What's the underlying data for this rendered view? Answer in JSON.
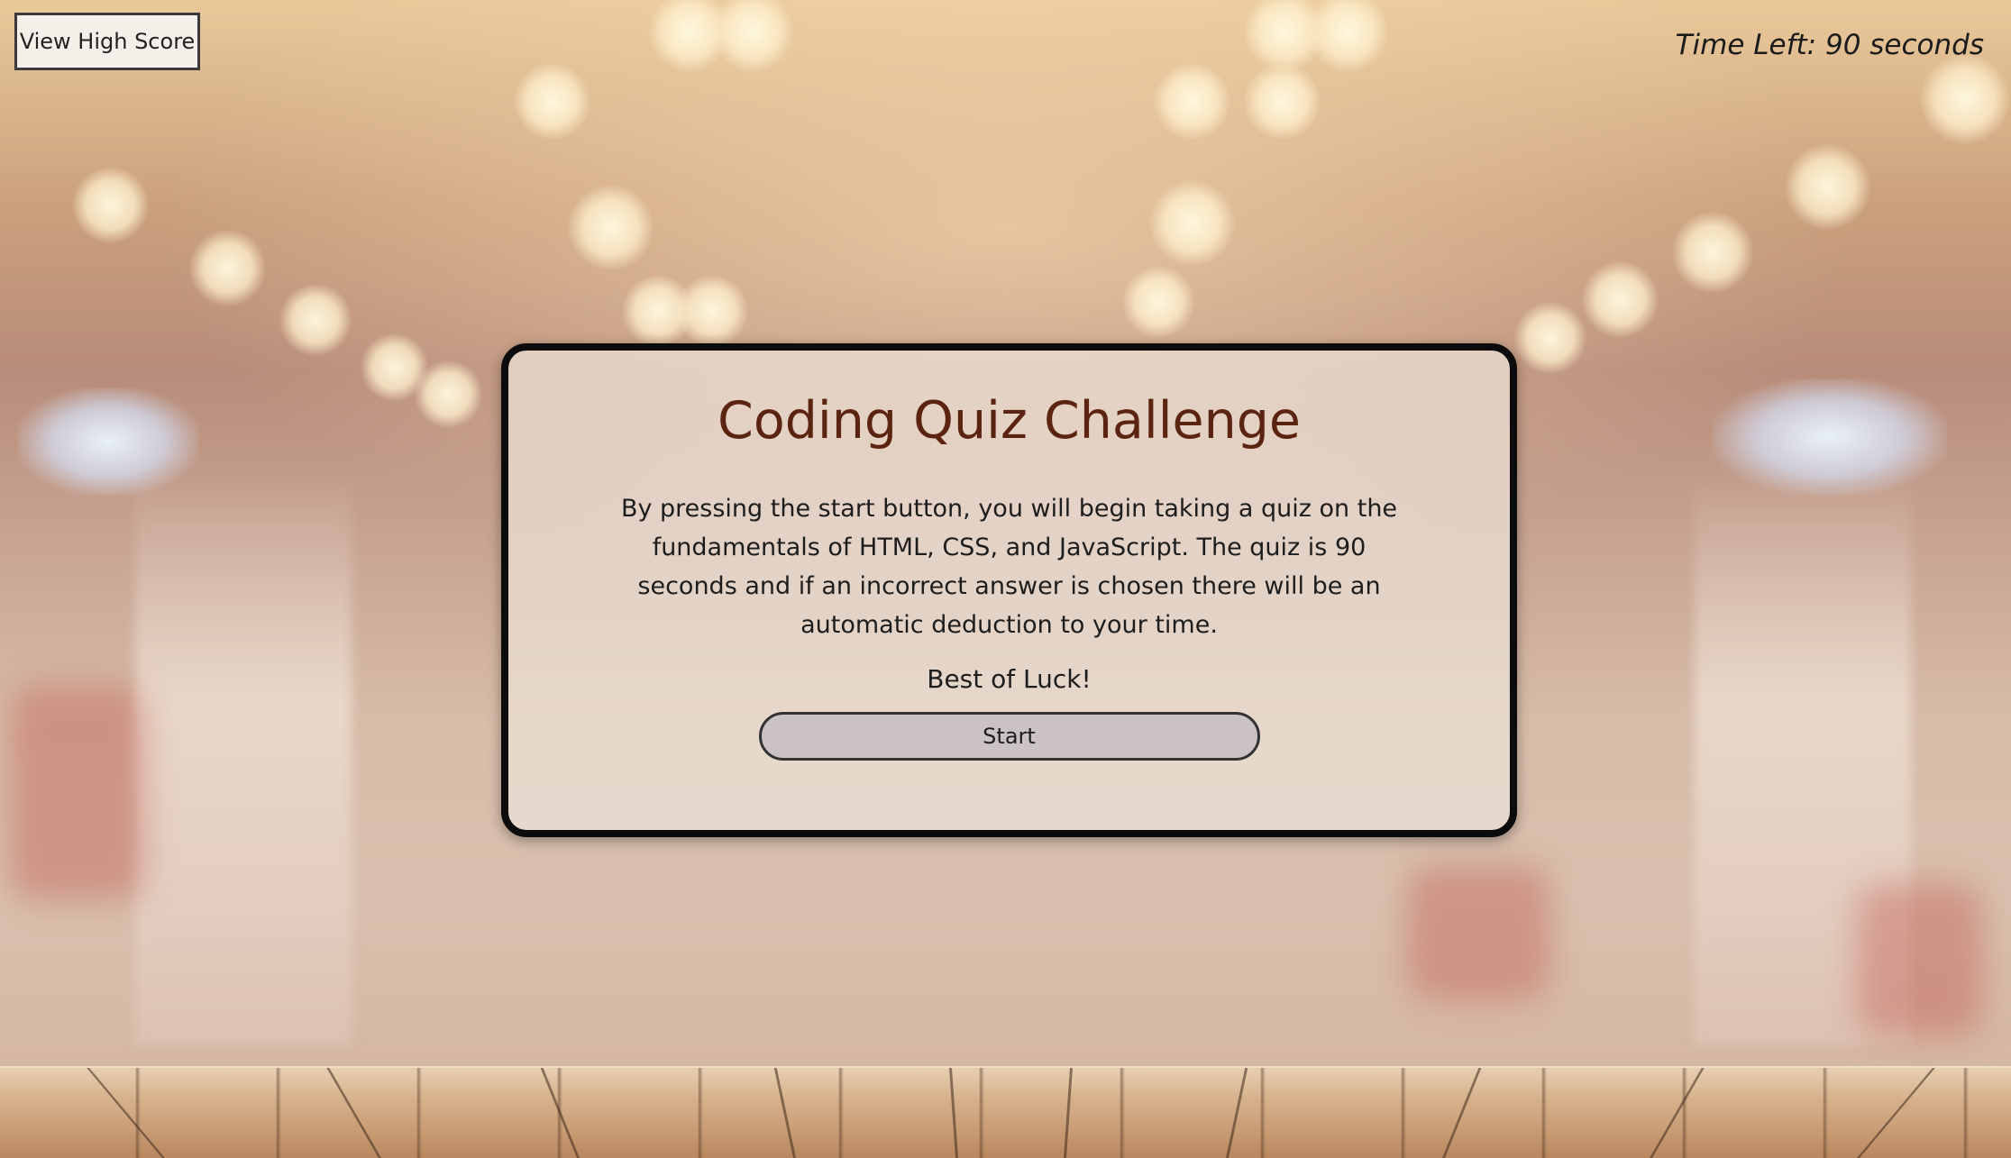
{
  "header": {
    "high_score_label": "View High Score",
    "timer_text": "Time Left: 90 seconds"
  },
  "quiz": {
    "title": "Coding Quiz Challenge",
    "description": "By pressing the start button, you will begin taking a quiz on the fundamentals of HTML, CSS, and JavaScript. The quiz is 90 seconds and if an incorrect answer is chosen there will be an automatic deduction to your time.",
    "closing": "Best of Luck!",
    "start_label": "Start"
  },
  "colors": {
    "title": "#5b2410",
    "card_border": "#0c0c0c",
    "button_fill": "#cbc3c3"
  }
}
